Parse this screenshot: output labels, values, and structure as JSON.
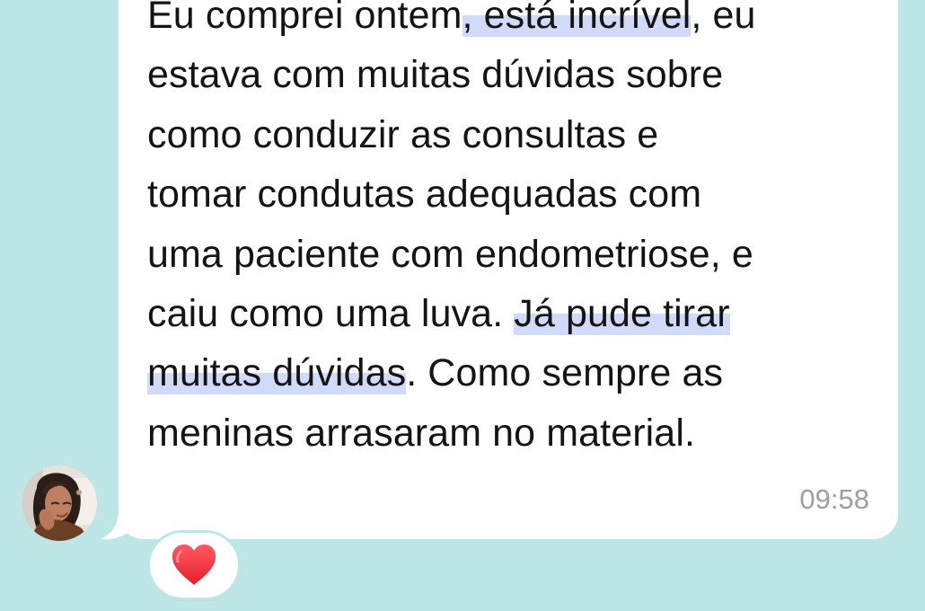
{
  "message": {
    "text_parts": [
      "Eu comprei ontem",
      ", está incrível",
      ", eu\nestava com muitas dúvidas sobre\ncomo conduzir as consultas e\ntomar condutas adequadas com\numa paciente com endometriose, e\ncaiu como uma luva. ",
      "Já pude tirar\nmuitas dúvidas",
      ". Como sempre as\nmeninas arrasaram no material."
    ],
    "time": "09:58"
  },
  "reaction": {
    "icon": "heart-icon",
    "color": "#f02f3b"
  },
  "avatar": {
    "icon": "avatar-photo",
    "accent_color": "#6a3f25"
  },
  "theme": {
    "chat_background": "#bfe6e6",
    "bubble_background": "#ffffff",
    "highlight_color": "#c1cdf7"
  }
}
